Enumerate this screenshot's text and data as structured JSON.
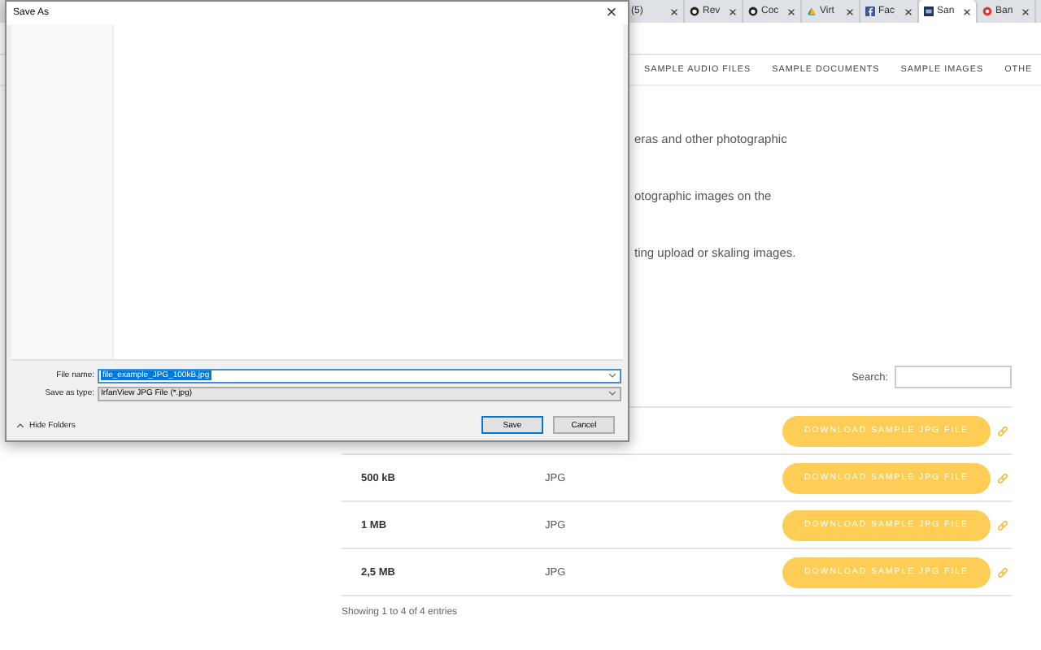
{
  "browser_tabs": [
    {
      "label": "(5)",
      "kind": "plain",
      "selected": false
    },
    {
      "label": "Rev",
      "kind": "github",
      "selected": false
    },
    {
      "label": "Coc",
      "kind": "github",
      "selected": false
    },
    {
      "label": "Virt",
      "kind": "drive",
      "selected": false
    },
    {
      "label": "Fac",
      "kind": "facebook",
      "selected": false
    },
    {
      "label": "San",
      "kind": "site",
      "selected": true
    },
    {
      "label": "Ban",
      "kind": "red",
      "selected": false
    }
  ],
  "nav": [
    "SAMPLE AUDIO FILES",
    "SAMPLE DOCUMENTS",
    "SAMPLE IMAGES",
    "OTHE"
  ],
  "paragraphs": [
    "eras and other photographic",
    "otographic images on the",
    "ting upload or skaling images."
  ],
  "search": {
    "label": "Search:"
  },
  "table": {
    "rows": [
      {
        "button": "DOWNLOAD SAMPLE JPG FILE"
      },
      {
        "size": "500 kB",
        "type": "JPG",
        "button": "DOWNLOAD SAMPLE JPG FILE"
      },
      {
        "size": "1 MB",
        "type": "JPG",
        "button": "DOWNLOAD SAMPLE JPG FILE"
      },
      {
        "size": "2,5 MB",
        "type": "JPG",
        "button": "DOWNLOAD SAMPLE JPG FILE"
      }
    ],
    "info": "Showing 1 to 4 of 4 entries"
  },
  "dialog": {
    "title": "Save As",
    "close": "×",
    "file_name": {
      "label": "File name:",
      "value": "file_example_JPG_100kB.jpg"
    },
    "save_as_type": {
      "label": "Save as type:",
      "value": "IrfanView JPG File (*.jpg)"
    },
    "hide_folders": "Hide Folders",
    "buttons": [
      "Save",
      "Cancel"
    ]
  }
}
